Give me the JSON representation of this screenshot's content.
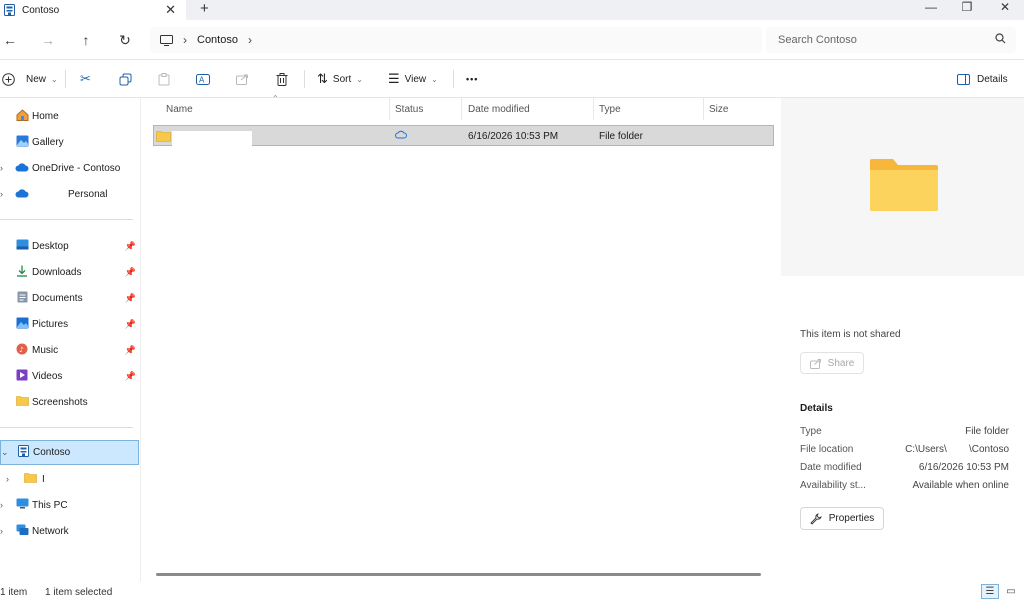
{
  "window": {
    "tab_title": "Contoso",
    "close_tab_glyph": "✕",
    "new_tab_glyph": "+",
    "minimize_glyph": "—",
    "restore_glyph": "❐",
    "close_glyph": "✕"
  },
  "nav": {
    "back_glyph": "←",
    "forward_glyph": "→",
    "up_glyph": "↑",
    "refresh_glyph": "↻",
    "breadcrumb": [
      "Contoso"
    ],
    "search_placeholder": "Search Contoso"
  },
  "toolbar": {
    "new_label": "New",
    "sort_label": "Sort",
    "view_label": "View",
    "more_glyph": "•••",
    "details_label": "Details"
  },
  "sidebar": {
    "top": [
      {
        "label": "Home",
        "icon": "home-icon"
      },
      {
        "label": "Gallery",
        "icon": "gallery-icon"
      },
      {
        "label": "OneDrive - Contoso",
        "icon": "cloud-icon"
      },
      {
        "label": "Personal",
        "icon": "cloud-icon"
      }
    ],
    "quick": [
      {
        "label": "Desktop",
        "icon": "desktop-icon"
      },
      {
        "label": "Downloads",
        "icon": "download-icon"
      },
      {
        "label": "Documents",
        "icon": "documents-icon"
      },
      {
        "label": "Pictures",
        "icon": "pictures-icon"
      },
      {
        "label": "Music",
        "icon": "music-icon"
      },
      {
        "label": "Videos",
        "icon": "videos-icon"
      },
      {
        "label": "Screenshots",
        "icon": "folder-icon"
      }
    ],
    "tree": [
      {
        "label": "Contoso",
        "icon": "building-icon"
      },
      {
        "label": "I",
        "icon": "folder-icon"
      },
      {
        "label": "This PC",
        "icon": "pc-icon"
      },
      {
        "label": "Network",
        "icon": "network-icon"
      }
    ]
  },
  "list": {
    "columns": [
      "Name",
      "Status",
      "Date modified",
      "Type",
      "Size"
    ],
    "rows": [
      {
        "name": "",
        "status_icon": "cloud-status-icon",
        "date": "6/16/2026 10:53 PM",
        "type": "File folder",
        "size": ""
      }
    ]
  },
  "details": {
    "not_shared": "This item is not shared",
    "share_label": "Share",
    "heading": "Details",
    "props": [
      {
        "label": "Type",
        "value": "File folder"
      },
      {
        "label": "File location",
        "value": "C:\\Users\\        \\Contoso"
      },
      {
        "label": "Date modified",
        "value": "6/16/2026 10:53 PM"
      },
      {
        "label": "Availability st...",
        "value": "Available when online"
      }
    ],
    "properties_label": "Properties"
  },
  "status": {
    "count": "1 item",
    "selected": "1 item selected"
  },
  "colors": {
    "accent": "#0067c0",
    "selection": "#cce8ff",
    "folder": "#f8c84a"
  }
}
